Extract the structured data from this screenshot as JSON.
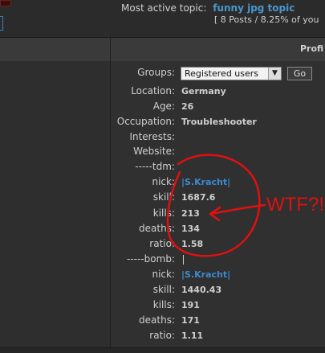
{
  "topbar": {
    "topic_label": "Most active topic:",
    "topic_link": "funny jpg topic",
    "topic_stats": "[ 8 Posts / 8.25% of you"
  },
  "header": {
    "title": "Profi"
  },
  "profile": {
    "groups_label": "Groups:",
    "groups_value": "Registered users",
    "go_label": "Go",
    "fields": [
      {
        "label": "Location:",
        "value": "Germany"
      },
      {
        "label": "Age:",
        "value": "26"
      },
      {
        "label": "Occupation:",
        "value": "Troubleshooter"
      },
      {
        "label": "Interests:",
        "value": ""
      },
      {
        "label": "Website:",
        "value": ""
      },
      {
        "label": "-----tdm:",
        "value": ""
      },
      {
        "label": "nick:",
        "value": "|S.Kracht|"
      },
      {
        "label": "skill:",
        "value": "1687.6"
      },
      {
        "label": "kills:",
        "value": "213"
      },
      {
        "label": "deaths:",
        "value": "134"
      },
      {
        "label": "ratio:",
        "value": "1.58"
      },
      {
        "label": "-----bomb:",
        "value": ""
      },
      {
        "label": "nick:",
        "value": "|S.Kracht|"
      },
      {
        "label": "skill:",
        "value": "1440.43"
      },
      {
        "label": "kills:",
        "value": "191"
      },
      {
        "label": "deaths:",
        "value": "171"
      },
      {
        "label": "ratio:",
        "value": "1.11"
      }
    ]
  },
  "annotation": {
    "text": "WTF?!",
    "color": "#e01010"
  },
  "colors": {
    "link": "#4a96cf",
    "nick": "#3b8ad0",
    "background": "#303030"
  }
}
